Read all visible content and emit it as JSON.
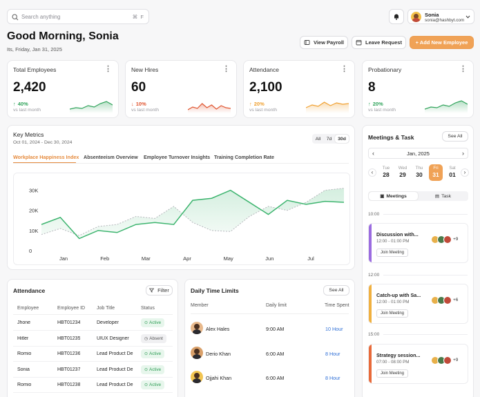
{
  "search": {
    "placeholder": "Search anything",
    "shortcut": "⌘  F"
  },
  "user": {
    "name": "Sonia",
    "email": "sonia@hashbyt.com"
  },
  "greeting": {
    "title": "Good Morning, Sonia",
    "date": "Its, Friday, Jan 31, 2025"
  },
  "actions": {
    "view_payroll": "View Payroll",
    "leave_request": "Leave Request",
    "add_employee": "+ Add New Employee"
  },
  "stats": [
    {
      "label": "Total Employees",
      "value": "2,420",
      "change": "40%",
      "direction": "up",
      "sub": "vs last month",
      "color": "#2fa35a"
    },
    {
      "label": "New Hires",
      "value": "60",
      "change": "10%",
      "direction": "down",
      "sub": "vs last month",
      "color": "#e0542f"
    },
    {
      "label": "Attendance",
      "value": "2,100",
      "change": "20%",
      "direction": "up",
      "sub": "vs last month",
      "color": "#f0a030"
    },
    {
      "label": "Probationary",
      "value": "8",
      "change": "20%",
      "direction": "up",
      "sub": "vs last month",
      "color": "#2fa35a"
    }
  ],
  "metrics": {
    "title": "Key Metrics",
    "range": "Oct 01, 2024 - Dec 30, 2024",
    "periods": [
      "All",
      "7d",
      "30d"
    ],
    "active_period": "30d",
    "tabs": [
      "Workplace Happiness Index",
      "Absenteeism Overview",
      "Employee Turnover Insights",
      "Training Completion Rate"
    ],
    "active_tab": 0
  },
  "chart_data": {
    "type": "line",
    "categories": [
      "Jan",
      "Feb",
      "Mar",
      "Apr",
      "May",
      "Jun",
      "Jul"
    ],
    "yticks": [
      "0",
      "10K",
      "20K",
      "30K"
    ],
    "ylim": [
      0,
      35000
    ],
    "grid": false,
    "series": [
      {
        "values": [
          13000,
          16500,
          6000,
          10000,
          9000,
          13000,
          14000,
          13000,
          25000,
          26000,
          30000,
          24000,
          18000,
          25000,
          23000,
          24500,
          24000
        ]
      },
      {
        "values": [
          8000,
          11000,
          7500,
          12000,
          13000,
          17000,
          16000,
          22000,
          14000,
          10000,
          9500,
          17000,
          22000,
          20000,
          24000,
          30000,
          31000
        ]
      }
    ]
  },
  "attendance": {
    "title": "Attendance",
    "filter_label": "Filter",
    "columns": [
      "Employee",
      "Employee ID",
      "Job Title",
      "Status"
    ],
    "rows": [
      {
        "name": "Jhone",
        "id": "HBT01234",
        "job": "Developer",
        "status": "Active"
      },
      {
        "name": "Hitler",
        "id": "HBT01235",
        "job": "UIUX Designer",
        "status": "Absent"
      },
      {
        "name": "Romio",
        "id": "HBT01236",
        "job": "Lead Product De",
        "status": "Active"
      },
      {
        "name": "Sonia",
        "id": "HBT01237",
        "job": "Lead Product De",
        "status": "Active"
      },
      {
        "name": "Romio",
        "id": "HBT01238",
        "job": "Lead Product De",
        "status": "Active"
      }
    ]
  },
  "time_limits": {
    "title": "Daily Time Limits",
    "see_all": "See All",
    "columns": [
      "Member",
      "Daily limit",
      "Time Spent"
    ],
    "rows": [
      {
        "name": "Alex Hales",
        "limit": "9:00 AM",
        "spent": "10 Hour"
      },
      {
        "name": "Derio Khan",
        "limit": "6:00 AM",
        "spent": "8 Hour"
      },
      {
        "name": "Ojjahi Khan",
        "limit": "6:00 AM",
        "spent": "8 Hour"
      }
    ]
  },
  "meetings": {
    "title": "Meetings & Task",
    "see_all": "See All",
    "month": "Jan, 2025",
    "days": [
      {
        "dn": "Tue",
        "dd": "28"
      },
      {
        "dn": "Wed",
        "dd": "29"
      },
      {
        "dn": "Thu",
        "dd": "30"
      },
      {
        "dn": "Fri",
        "dd": "31"
      },
      {
        "dn": "Sat",
        "dd": "01"
      }
    ],
    "selected_day": 3,
    "tabs": [
      "Meetings",
      "Task"
    ],
    "times": [
      "10:00",
      "12:00",
      "15:00"
    ],
    "events": [
      {
        "title": "Discussion with...",
        "time": "12:00 - 01:00 PM",
        "extra": "+9",
        "join": "Join Meeting",
        "color": "#9b6ce0"
      },
      {
        "title": "Catch-up with Sa...",
        "time": "12:00 - 01:00 PM",
        "extra": "+6",
        "join": "Join Meeting",
        "color": "#f0b040"
      },
      {
        "title": "Strategy session...",
        "time": "07:00 - 08:00 PM",
        "extra": "+9",
        "join": "Join Meeting",
        "color": "#e86a3a"
      }
    ]
  }
}
